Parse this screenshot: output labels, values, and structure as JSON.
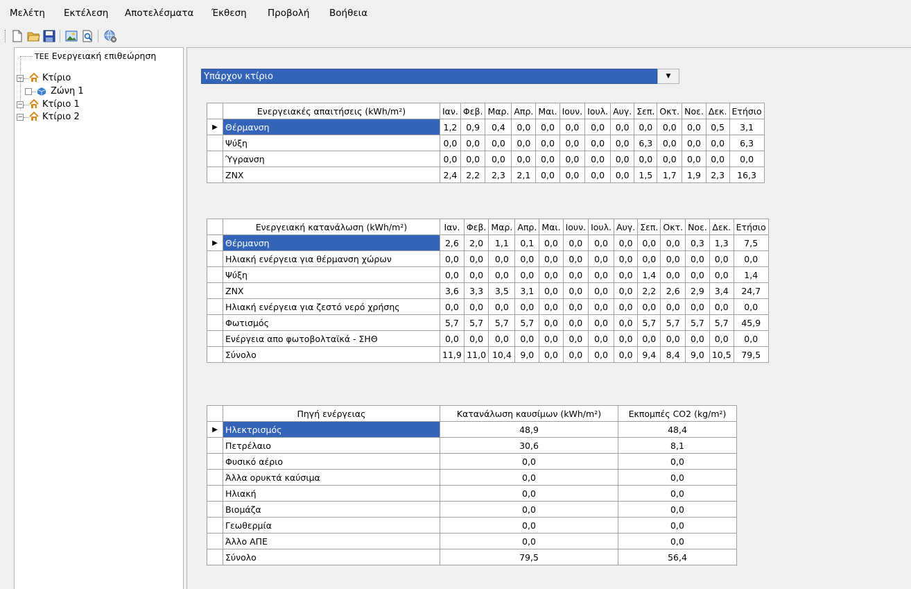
{
  "menu": [
    "Μελέτη",
    "Εκτέλεση",
    "Αποτελέσματα",
    "Έκθεση",
    "Προβολή",
    "Βοήθεια"
  ],
  "toolbar": {
    "icons": [
      "new-file-icon",
      "open-folder-icon",
      "save-icon",
      "picture-icon",
      "print-preview-icon",
      "globe-settings-icon"
    ]
  },
  "tree": {
    "root": "Ενεργειακή επιθεώρηση",
    "root_prefix": "ΤΕΕ",
    "nodes": [
      {
        "label": "Κτίριο",
        "children": [
          {
            "label": "Ζώνη 1"
          }
        ]
      },
      {
        "label": "Κτίριο 1"
      },
      {
        "label": "Κτίριο 2"
      }
    ]
  },
  "building_select": {
    "value": "Υπάρχον κτίριο"
  },
  "months": [
    "Ιαν.",
    "Φεβ.",
    "Μαρ.",
    "Απρ.",
    "Μαι.",
    "Ιουν.",
    "Ιουλ.",
    "Αυγ.",
    "Σεπ.",
    "Οκτ.",
    "Νοε.",
    "Δεκ.",
    "Ετήσιο"
  ],
  "demand_table": {
    "header": "Ενεργειακές απαιτήσεις (kWh/m²)",
    "rows": [
      {
        "name": "Θέρμανση",
        "values": [
          "1,2",
          "0,9",
          "0,4",
          "0,0",
          "0,0",
          "0,0",
          "0,0",
          "0,0",
          "0,0",
          "0,0",
          "0,0",
          "0,5",
          "3,1"
        ]
      },
      {
        "name": "Ψύξη",
        "values": [
          "0,0",
          "0,0",
          "0,0",
          "0,0",
          "0,0",
          "0,0",
          "0,0",
          "0,0",
          "6,3",
          "0,0",
          "0,0",
          "0,0",
          "6,3"
        ]
      },
      {
        "name": "Ύγρανση",
        "values": [
          "0,0",
          "0,0",
          "0,0",
          "0,0",
          "0,0",
          "0,0",
          "0,0",
          "0,0",
          "0,0",
          "0,0",
          "0,0",
          "0,0",
          "0,0"
        ]
      },
      {
        "name": "ZNX",
        "values": [
          "2,4",
          "2,2",
          "2,3",
          "2,1",
          "0,0",
          "0,0",
          "0,0",
          "0,0",
          "1,5",
          "1,7",
          "1,9",
          "2,3",
          "16,3"
        ]
      }
    ]
  },
  "consumption_table": {
    "header": "Ενεργειακή κατανάλωση (kWh/m²)",
    "rows": [
      {
        "name": "Θέρμανση",
        "values": [
          "2,6",
          "2,0",
          "1,1",
          "0,1",
          "0,0",
          "0,0",
          "0,0",
          "0,0",
          "0,0",
          "0,0",
          "0,3",
          "1,3",
          "7,5"
        ]
      },
      {
        "name": "Ηλιακή ενέργεια για θέρμανση χώρων",
        "values": [
          "0,0",
          "0,0",
          "0,0",
          "0,0",
          "0,0",
          "0,0",
          "0,0",
          "0,0",
          "0,0",
          "0,0",
          "0,0",
          "0,0",
          "0,0"
        ]
      },
      {
        "name": "Ψύξη",
        "values": [
          "0,0",
          "0,0",
          "0,0",
          "0,0",
          "0,0",
          "0,0",
          "0,0",
          "0,0",
          "1,4",
          "0,0",
          "0,0",
          "0,0",
          "1,4"
        ]
      },
      {
        "name": "ZNX",
        "values": [
          "3,6",
          "3,3",
          "3,5",
          "3,1",
          "0,0",
          "0,0",
          "0,0",
          "0,0",
          "2,2",
          "2,6",
          "2,9",
          "3,4",
          "24,7"
        ]
      },
      {
        "name": "Ηλιακή ενέργεια για ζεστό νερό χρήσης",
        "values": [
          "0,0",
          "0,0",
          "0,0",
          "0,0",
          "0,0",
          "0,0",
          "0,0",
          "0,0",
          "0,0",
          "0,0",
          "0,0",
          "0,0",
          "0,0"
        ]
      },
      {
        "name": "Φωτισμός",
        "values": [
          "5,7",
          "5,7",
          "5,7",
          "5,7",
          "0,0",
          "0,0",
          "0,0",
          "0,0",
          "5,7",
          "5,7",
          "5,7",
          "5,7",
          "45,9"
        ]
      },
      {
        "name": "Ενέργεια απο φωτοβολταϊκά - ΣΗΘ",
        "values": [
          "0,0",
          "0,0",
          "0,0",
          "0,0",
          "0,0",
          "0,0",
          "0,0",
          "0,0",
          "0,0",
          "0,0",
          "0,0",
          "0,0",
          "0,0"
        ]
      },
      {
        "name": "Σύνολο",
        "values": [
          "11,9",
          "11,0",
          "10,4",
          "9,0",
          "0,0",
          "0,0",
          "0,0",
          "0,0",
          "9,4",
          "8,4",
          "9,0",
          "10,5",
          "79,5"
        ]
      }
    ]
  },
  "source_table": {
    "headers": [
      "Πηγή ενέργειας",
      "Κατανάλωση καυσίμων (kWh/m²)",
      "Εκπομπές CO2 (kg/m²)"
    ],
    "rows": [
      {
        "name": "Ηλεκτρισμός",
        "consumption": "48,9",
        "emissions": "48,4"
      },
      {
        "name": "Πετρέλαιο",
        "consumption": "30,6",
        "emissions": "8,1"
      },
      {
        "name": "Φυσικό αέριο",
        "consumption": "0,0",
        "emissions": "0,0"
      },
      {
        "name": "Άλλα ορυκτά καύσιμα",
        "consumption": "0,0",
        "emissions": "0,0"
      },
      {
        "name": "Ηλιακή",
        "consumption": "0,0",
        "emissions": "0,0"
      },
      {
        "name": "Βιομάζα",
        "consumption": "0,0",
        "emissions": "0,0"
      },
      {
        "name": "Γεωθερμία",
        "consumption": "0,0",
        "emissions": "0,0"
      },
      {
        "name": "Άλλο ΑΠΕ",
        "consumption": "0,0",
        "emissions": "0,0"
      },
      {
        "name": "Σύνολο",
        "consumption": "79,5",
        "emissions": "56,4"
      }
    ]
  },
  "colors": {
    "selection": "#3464b8",
    "house_icon": "#d98a1c",
    "zone_icon": "#3b7fd0"
  },
  "row_marker": "▶"
}
